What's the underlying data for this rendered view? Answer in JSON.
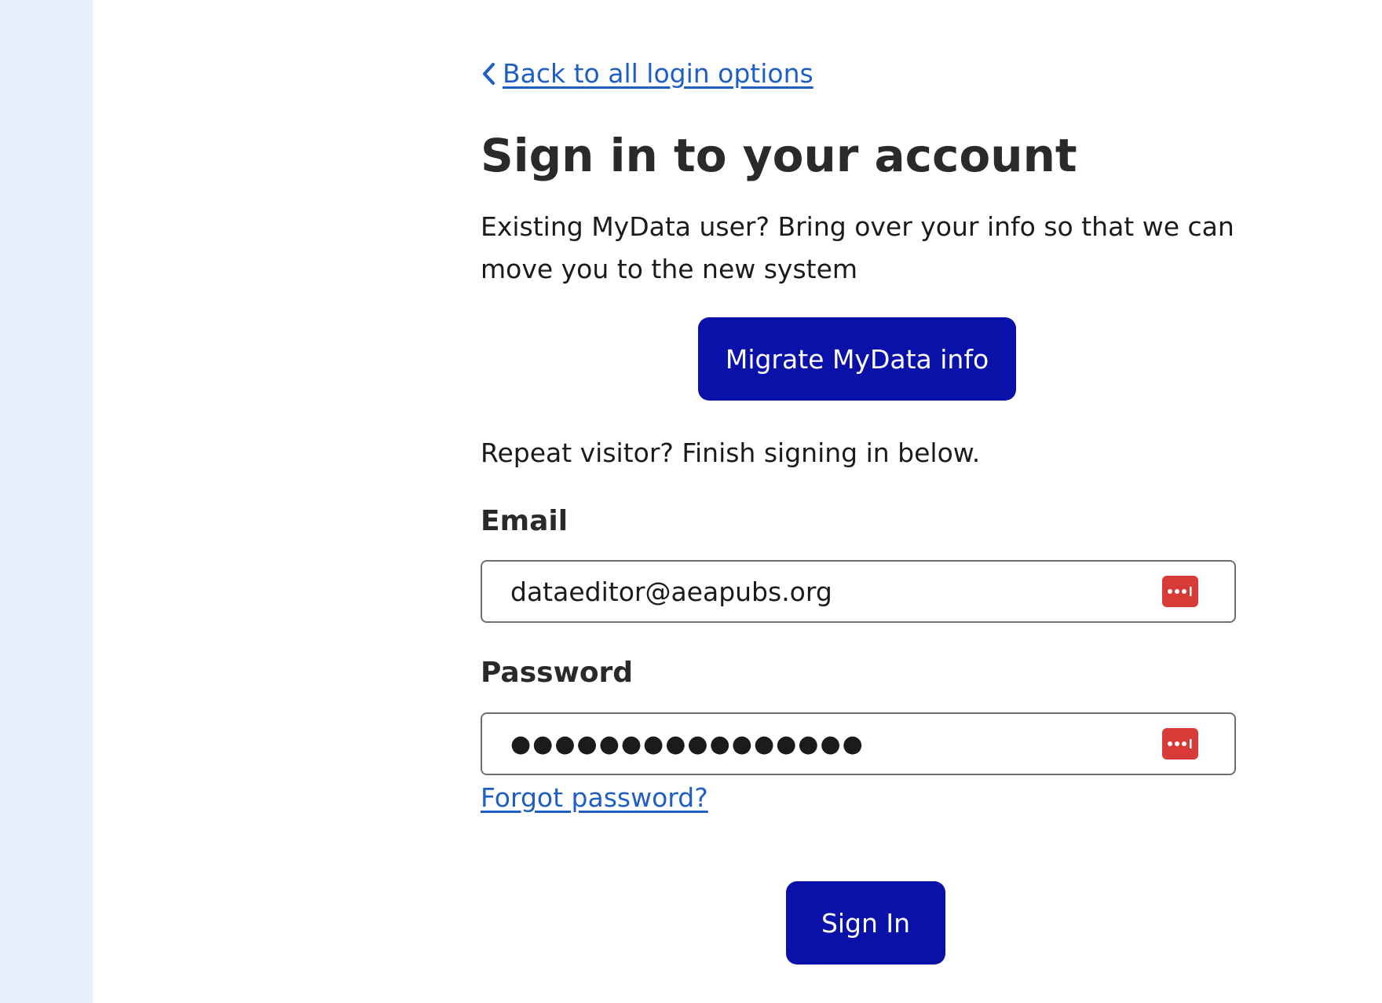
{
  "back_link": {
    "label": "Back to all login options",
    "icon": "chevron-left-icon"
  },
  "page_title": "Sign in to your account",
  "intro_text": "Existing MyData user? Bring over your info so that we can move you to the new system",
  "migrate_button": {
    "label": "Migrate MyData info"
  },
  "repeat_text": "Repeat visitor? Finish signing in below.",
  "email": {
    "label": "Email",
    "value": "dataeditor@aeapubs.org",
    "extension_icon": "password-manager-icon"
  },
  "password": {
    "label": "Password",
    "value": "●●●●●●●●●●●●●●●●",
    "extension_icon": "password-manager-icon"
  },
  "forgot_link": {
    "label": "Forgot password?"
  },
  "signin_button": {
    "label": "Sign In"
  },
  "colors": {
    "primary": "#0a11a8",
    "link": "#1f5fc4",
    "rail": "#e8eefc",
    "pm_icon": "#d83b37"
  }
}
